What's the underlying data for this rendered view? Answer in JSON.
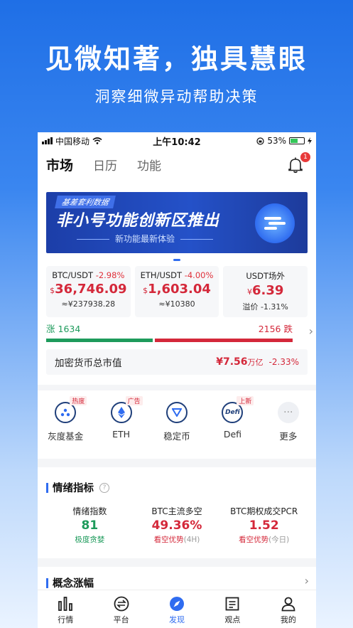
{
  "promo": {
    "title": "见微知著，独具慧眼",
    "subtitle": "洞察细微异动帮助决策"
  },
  "status_bar": {
    "carrier": "中国移动",
    "time": "上午10:42",
    "battery": "53%",
    "battery_level": 0.53
  },
  "top_nav": {
    "tabs": [
      {
        "label": "市场",
        "active": true
      },
      {
        "label": "日历",
        "active": false
      },
      {
        "label": "功能",
        "active": false
      }
    ],
    "notification_count": "1"
  },
  "banner": {
    "tag": "基差套利数据",
    "headline": "非小号功能创新区推出",
    "subline": "新功能最新体验"
  },
  "tickers": [
    {
      "pair": "BTC/USDT",
      "change": "-2.98%",
      "currency": "$",
      "price": "36,746.09",
      "sub": "≈¥237938.28"
    },
    {
      "pair": "ETH/USDT",
      "change": "-4.00%",
      "currency": "$",
      "price": "1,603.04",
      "sub": "≈¥10380"
    },
    {
      "pair": "USDT场外",
      "change": "",
      "currency": "¥",
      "price": "6.39",
      "sub": "溢价 -1.31%"
    }
  ],
  "ratio": {
    "up_label": "涨",
    "up_count": "1634",
    "down_label": "跌",
    "down_count": "2156"
  },
  "market_cap": {
    "label": "加密货币总市值",
    "value": "¥7.56",
    "unit": "万亿",
    "change": "-2.33%"
  },
  "quick_links": [
    {
      "label": "灰度基金",
      "badge": "热度",
      "icon": "grayscale-icon"
    },
    {
      "label": "ETH",
      "badge": "广告",
      "icon": "eth-icon"
    },
    {
      "label": "稳定币",
      "badge": "",
      "icon": "stablecoin-icon"
    },
    {
      "label": "Defi",
      "badge": "上新",
      "icon": "defi-icon"
    },
    {
      "label": "更多",
      "badge": "",
      "icon": "more-icon"
    }
  ],
  "sentiment": {
    "title": "情绪指标",
    "items": [
      {
        "title": "情绪指数",
        "value": "81",
        "desc": "极度贪婪",
        "note": ""
      },
      {
        "title": "BTC主流多空",
        "value": "49.36%",
        "desc": "看空优势",
        "note": "(4H)"
      },
      {
        "title": "BTC期权成交PCR",
        "value": "1.52",
        "desc": "看空优势",
        "note": "(今日)"
      }
    ]
  },
  "concept": {
    "title": "概念涨幅"
  },
  "bottom_nav": [
    {
      "label": "行情",
      "icon": "chart-bars-icon",
      "active": false
    },
    {
      "label": "平台",
      "icon": "exchange-icon",
      "active": false
    },
    {
      "label": "发现",
      "icon": "compass-icon",
      "active": true
    },
    {
      "label": "观点",
      "icon": "article-icon",
      "active": false
    },
    {
      "label": "我的",
      "icon": "user-icon",
      "active": false
    }
  ],
  "colors": {
    "accent": "#2f6cf0",
    "up": "#1e9b5c",
    "down": "#d4283a"
  }
}
